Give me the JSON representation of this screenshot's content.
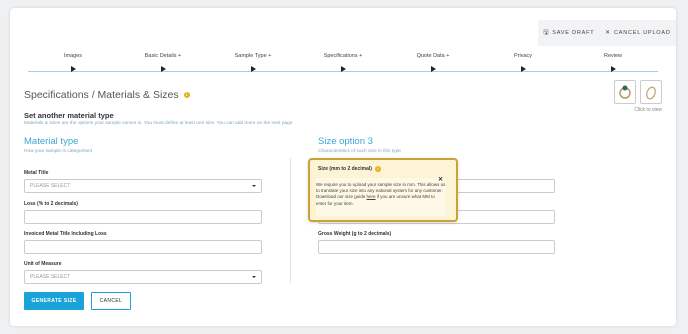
{
  "topbar": {
    "save_draft": "SAVE DRAFT",
    "cancel_upload": "CANCEL UPLOAD"
  },
  "steps": [
    {
      "label": "Images"
    },
    {
      "label": "Basic Details +"
    },
    {
      "label": "Sample Type +"
    },
    {
      "label": "Specifications +"
    },
    {
      "label": "Quote Data +"
    },
    {
      "label": "Privacy"
    },
    {
      "label": "Review"
    }
  ],
  "page": {
    "title": "Specifications / Materials & Sizes",
    "click_to_view": "Click to view",
    "subtitle": "Set another material type",
    "subtitle_desc": "Materials & sizes are the options your sample comes in. You must define at least one size. You can add more on the next page"
  },
  "left": {
    "heading": "Material type",
    "subheading": "How your sample is categorised",
    "metal_title_label": "Metal Title",
    "metal_title_value": "PLEASE SELECT",
    "loss_label": "Loss (% to 2 decimals)",
    "invoiced_label": "Invoiced Metal Title Including Loss",
    "unit_label": "Unit of Measure",
    "unit_value": "PLEASE SELECT"
  },
  "right": {
    "heading": "Size option 3",
    "subheading": "Characteristics of each size in this type",
    "size_label": "Size (mm to 2 decimal)",
    "gross_weight_label": "Gross Weight (g to 2 decimals)"
  },
  "tooltip": {
    "close": "✕",
    "text_before": "We require you to upload your sample size in mm. This allows us to translate your size into any national system for any customer. Download our size guide ",
    "link": "here",
    "text_after": " if you are unsure what MM to enter for your item."
  },
  "actions": {
    "generate": "GENERATE SIZE",
    "cancel": "CANCEL"
  },
  "colors": {
    "accent": "#1aa3d9",
    "heading": "#3ca6d6",
    "tooltip_border": "#caa23a",
    "info": "#e3b21a"
  }
}
